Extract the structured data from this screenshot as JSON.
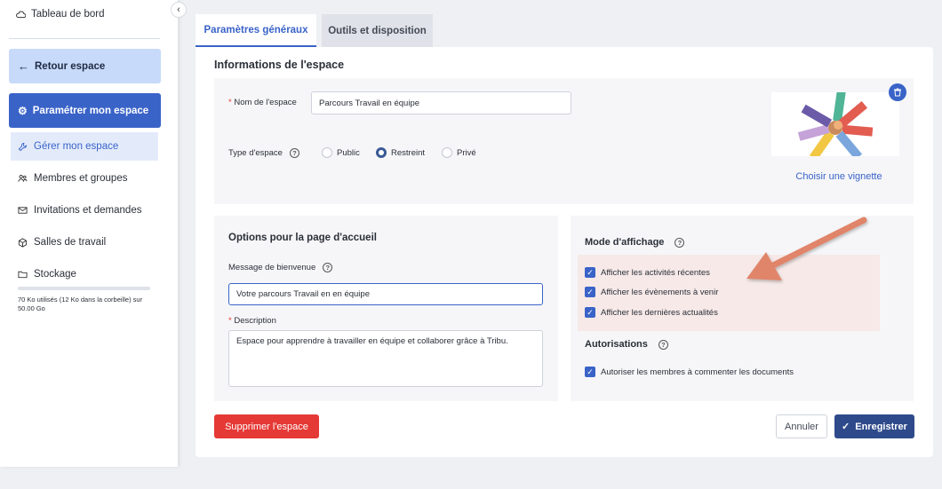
{
  "sidebar": {
    "dashboard_label": "Tableau de bord",
    "back_label": "Retour espace",
    "configure_label": "Paramétrer mon espace",
    "items": [
      {
        "label": "Gérer mon espace",
        "icon": "wrench-icon"
      },
      {
        "label": "Membres et groupes",
        "icon": "users-icon"
      },
      {
        "label": "Invitations et demandes",
        "icon": "mail-icon"
      },
      {
        "label": "Salles de travail",
        "icon": "cube-icon"
      },
      {
        "label": "Stockage",
        "icon": "folder-icon"
      }
    ],
    "storage": {
      "text": "70 Ko utilisés (12 Ko dans la corbeille) sur 50.00 Go",
      "used_fraction": 0.0
    }
  },
  "tabs": [
    {
      "label": "Paramètres généraux",
      "active": true
    },
    {
      "label": "Outils et disposition",
      "active": false
    }
  ],
  "info": {
    "title": "Informations de l'espace",
    "name_label": "Nom de l'espace",
    "name_value": "Parcours Travail en équipe",
    "type_label": "Type d'espace",
    "type_options": [
      "Public",
      "Restreint",
      "Privé"
    ],
    "type_selected": "Restreint",
    "choose_thumbnail": "Choisir une vignette"
  },
  "home_options": {
    "title": "Options pour la page d'accueil",
    "welcome_label": "Message de bienvenue",
    "welcome_value": "Votre parcours Travail en en équipe",
    "description_label": "Description",
    "description_value": "Espace pour apprendre à travailler en équipe et collaborer grâce à Tribu."
  },
  "display": {
    "title": "Mode d'affichage",
    "options": [
      "Afficher les activités récentes",
      "Afficher les évènements à venir",
      "Afficher les dernières actualités"
    ]
  },
  "authorizations": {
    "title": "Autorisations",
    "option": "Autoriser les membres à commenter les documents"
  },
  "actions": {
    "delete": "Supprimer l'espace",
    "cancel": "Annuler",
    "save": "Enregistrer"
  },
  "colors": {
    "primary": "#3a63c8",
    "danger": "#e53935",
    "save": "#2e4a8a",
    "arrow": "#e0856a"
  }
}
